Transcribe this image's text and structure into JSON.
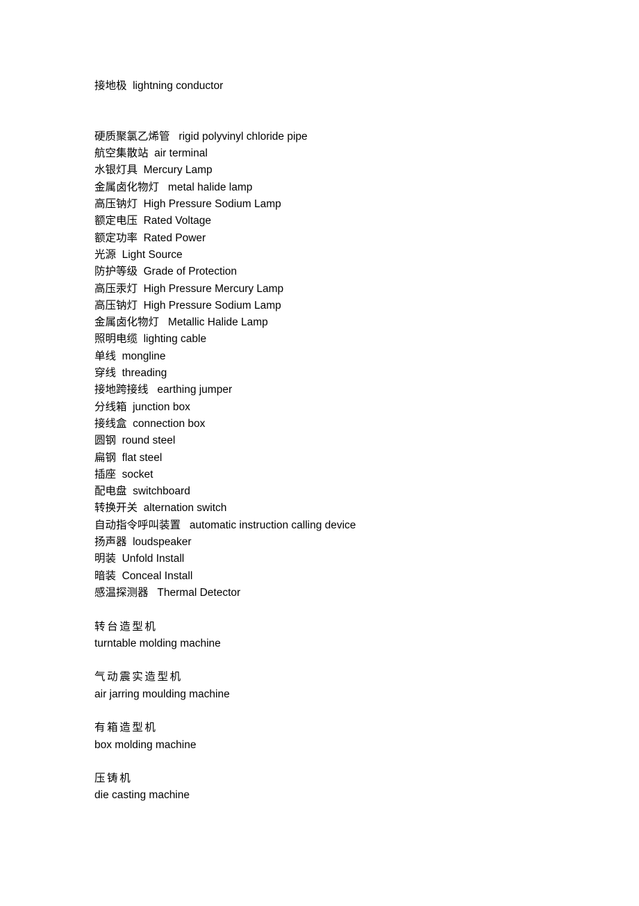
{
  "document": {
    "background_color": "#ffffff",
    "text_color": "#000000",
    "intro": {
      "line": "接地极  lightning conductor"
    },
    "glossary_lines": [
      "硬质聚氯乙烯管   rigid polyvinyl chloride pipe",
      "航空集散站  air terminal",
      "水银灯具  Mercury Lamp",
      "金属卤化物灯   metal halide lamp",
      "高压钠灯  High Pressure Sodium Lamp",
      "额定电压  Rated Voltage",
      "额定功率  Rated Power",
      "光源  Light Source",
      "防护等级  Grade of Protection",
      "高压汞灯  High Pressure Mercury Lamp",
      "高压钠灯  High Pressure Sodium Lamp",
      "金属卤化物灯   Metallic Halide Lamp",
      "照明电缆  lighting cable",
      "单线  mongline",
      "穿线  threading",
      "接地跨接线   earthing jumper",
      "分线箱  junction box",
      "接线盒  connection box",
      "圆钢  round steel",
      "扁钢  flat steel",
      "插座  socket",
      "配电盘  switchboard",
      "转换开关  alternation switch",
      "自动指令呼叫装置   automatic instruction calling device",
      "扬声器  loudspeaker",
      "明装  Unfold Install",
      "暗装  Conceal Install",
      "感温探测器   Thermal Detector"
    ],
    "machine_entries": [
      {
        "chinese": "转台造型机",
        "english": "turntable molding machine"
      },
      {
        "chinese": "气动震实造型机",
        "english": "air jarring moulding machine"
      },
      {
        "chinese": "有箱造型机",
        "english": "box molding machine"
      },
      {
        "chinese": "压铸机",
        "english": "die casting machine"
      }
    ]
  }
}
